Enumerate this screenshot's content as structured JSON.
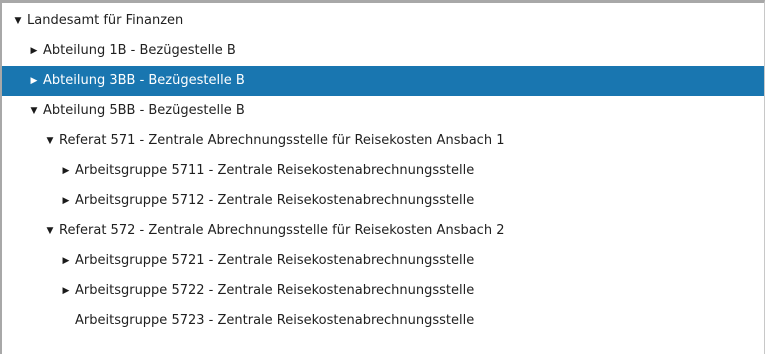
{
  "tree": {
    "nodes": [
      {
        "label": "Landesamt für Finanzen",
        "level": 0,
        "state": "expanded",
        "selected": false
      },
      {
        "label": "Abteilung 1B - Bezügestelle B",
        "level": 1,
        "state": "collapsed",
        "selected": false
      },
      {
        "label": "Abteilung 3BB - Bezügestelle B",
        "level": 1,
        "state": "collapsed",
        "selected": true
      },
      {
        "label": "Abteilung 5BB - Bezügestelle B",
        "level": 1,
        "state": "expanded",
        "selected": false
      },
      {
        "label": "Referat 571 - Zentrale Abrechnungsstelle für Reisekosten Ansbach 1",
        "level": 2,
        "state": "expanded",
        "selected": false
      },
      {
        "label": "Arbeitsgruppe 5711 - Zentrale Reisekostenabrechnungsstelle",
        "level": 3,
        "state": "collapsed",
        "selected": false
      },
      {
        "label": "Arbeitsgruppe 5712 - Zentrale Reisekostenabrechnungsstelle",
        "level": 3,
        "state": "collapsed",
        "selected": false
      },
      {
        "label": "Referat 572 - Zentrale Abrechnungsstelle für Reisekosten Ansbach 2",
        "level": 2,
        "state": "expanded",
        "selected": false
      },
      {
        "label": "Arbeitsgruppe 5721 - Zentrale Reisekostenabrechnungsstelle",
        "level": 3,
        "state": "collapsed",
        "selected": false
      },
      {
        "label": "Arbeitsgruppe 5722 - Zentrale Reisekostenabrechnungsstelle",
        "level": 3,
        "state": "collapsed",
        "selected": false
      },
      {
        "label": "Arbeitsgruppe 5723 - Zentrale Reisekostenabrechnungsstelle",
        "level": 3,
        "state": "leaf",
        "selected": false
      }
    ]
  },
  "icons": {
    "expanded": "triangle-down-icon",
    "collapsed": "triangle-right-icon"
  },
  "colors": {
    "selection_background": "#1976b0",
    "selection_text": "#ffffff",
    "text": "#1f1f1f"
  }
}
